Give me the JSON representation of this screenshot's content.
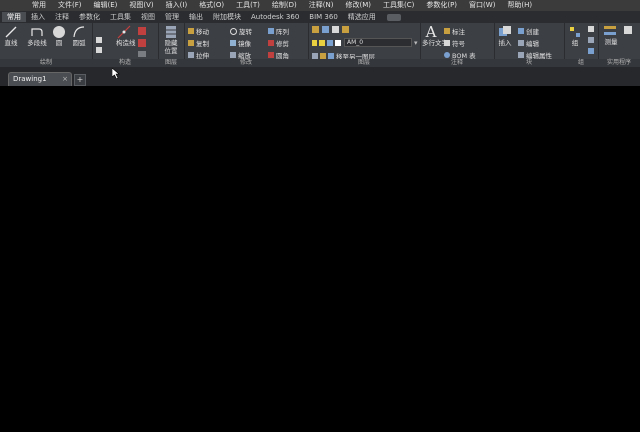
{
  "menu": [
    "常用",
    "文件(F)",
    "编辑(E)",
    "视图(V)",
    "插入(I)",
    "格式(O)",
    "工具(T)",
    "绘制(D)",
    "注释(N)",
    "修改(M)",
    "工具集(C)",
    "参数化(P)",
    "窗口(W)",
    "帮助(H)"
  ],
  "tabs": [
    "常用",
    "插入",
    "注释",
    "参数化",
    "工具集",
    "视图",
    "管理",
    "输出",
    "附加模块",
    "Autodesk 360",
    "BIM 360",
    "精选应用"
  ],
  "draw": {
    "line": "直线",
    "polyline": "多段线",
    "circle": "圆",
    "arc": "圆弧",
    "footer": "绘制"
  },
  "construct": {
    "cline": "构造线",
    "footer": "构造"
  },
  "layout": {
    "hide": "隐藏",
    "position": "位置",
    "footer": "图层"
  },
  "modify": {
    "move": "移动",
    "rotate": "旋转",
    "array": "阵列",
    "copy": "复制",
    "mirror": "镜像",
    "trim": "修剪",
    "stretch": "拉伸",
    "scale": "缩放",
    "fillet": "圆角",
    "footer": "修改"
  },
  "layers": {
    "layer_name": "AM_0",
    "match_layer": "移至另一图层",
    "footer": "图层"
  },
  "annotation": {
    "multitext": "多行文字",
    "dimension": "标注",
    "symbol": "符号",
    "bom": "BOM 表",
    "footer": "注释"
  },
  "block": {
    "insert": "插入",
    "create": "创建",
    "edit": "编辑",
    "edit_attr": "编辑属性",
    "footer": "块"
  },
  "groups": {
    "group": "组",
    "footer": "组"
  },
  "utilities": {
    "measure": "测量",
    "footer": "实用程序"
  },
  "document": {
    "tab": "Drawing1",
    "close": "×",
    "new_tab": "+"
  }
}
